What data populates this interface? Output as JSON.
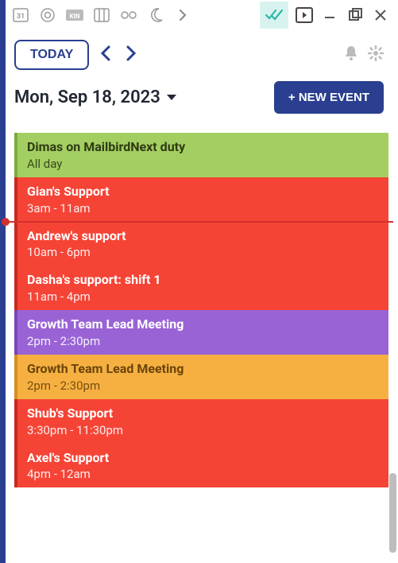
{
  "toolbar": {
    "leftIcons": [
      "calendar-31-icon",
      "chrome-icon",
      "kin-icon",
      "board-icon",
      "link-icon",
      "moon-icon",
      "chevron-right-icon"
    ],
    "rightIcons": [
      "double-check-icon",
      "sidebar-toggle-icon",
      "minimize-icon",
      "maximize-icon",
      "close-icon"
    ]
  },
  "header": {
    "today_label": "TODAY",
    "date_label": "Mon, Sep 18, 2023",
    "new_event_label": "+ NEW EVENT"
  },
  "events": [
    {
      "title": "Dimas on MailbirdNext duty",
      "time": "All day",
      "color": "green"
    },
    {
      "title": "Gian's Support",
      "time": "3am - 11am",
      "color": "red"
    },
    {
      "nowline": true
    },
    {
      "title": "Andrew's support",
      "time": "10am - 6pm",
      "color": "red"
    },
    {
      "title": "Dasha's support: shift 1",
      "time": "11am - 4pm",
      "color": "red"
    },
    {
      "title": "Growth Team Lead Meeting",
      "time": "2pm - 2:30pm",
      "color": "purple"
    },
    {
      "title": "Growth Team Lead Meeting",
      "time": "2pm - 2:30pm",
      "color": "orange"
    },
    {
      "title": "Shub's Support",
      "time": "3:30pm - 11:30pm",
      "color": "red"
    },
    {
      "title": "Axel's Support",
      "time": "4pm - 12am",
      "color": "red"
    }
  ]
}
